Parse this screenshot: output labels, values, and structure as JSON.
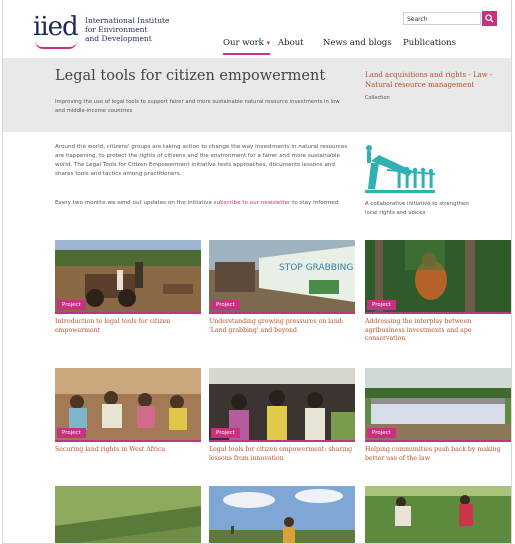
{
  "header": {
    "logo_mark": "iied",
    "logo_lines": [
      "International Institute",
      "for Environment",
      "and Development"
    ],
    "search_placeholder": "Search",
    "search_icon": "magnifier-icon"
  },
  "nav": [
    {
      "label": "Our work",
      "chevron": "▾",
      "active": true
    },
    {
      "label": "About",
      "active": false
    },
    {
      "label": "News and blogs",
      "active": false
    },
    {
      "label": "Publications",
      "active": false
    }
  ],
  "banner": {
    "title": "Legal tools for citizen empowerment",
    "subtitle": "Improving the use of legal tools to support fairer and more sustainable natural resource investments in low and middle-income countries",
    "side_title": "Land acquisitions and rights - Law - Natural resource management",
    "side_label": "Collection"
  },
  "intro": {
    "paragraph": "Around the world, citizens' groups are taking action to change the way investments in natural resources are happening, to protect the rights of citizens and the environment for a fairer and more sustainable world. The Legal Tools for Citizen Empowerment initiative tests approaches, documents lessons and shares tools and tactics among practitioners.",
    "updates_before": "Every two months we send out updates on the initiative ",
    "updates_link": "subscribe to our newsletter",
    "updates_after": " to stay informed",
    "illustration_caption": "A collaborative initiative to strengthen local rights and voices",
    "accent_color": "#2fb0b3"
  },
  "cards": [
    {
      "badge": "Project",
      "title": "Introduction to legal tools for citizen empowerment"
    },
    {
      "badge": "Project",
      "title": "Understanding growing pressures on land: 'Land grabbing' and beyond"
    },
    {
      "badge": "Project",
      "title": "Addressing the interplay between agribusiness investments and ape conservation"
    },
    {
      "badge": "Project",
      "title": "Securing land rights in West Africa"
    },
    {
      "badge": "Project",
      "title": "Legal tools for citizen empowerment: sharing lessons from innovation"
    },
    {
      "badge": "Project",
      "title": "Helping communities push back by making better use of the law"
    },
    {
      "badge": "",
      "title": ""
    },
    {
      "badge": "",
      "title": ""
    },
    {
      "badge": "",
      "title": ""
    }
  ],
  "colors": {
    "brand": "#c4337f",
    "link_title": "#b5502c",
    "logo": "#1c2a5a"
  }
}
